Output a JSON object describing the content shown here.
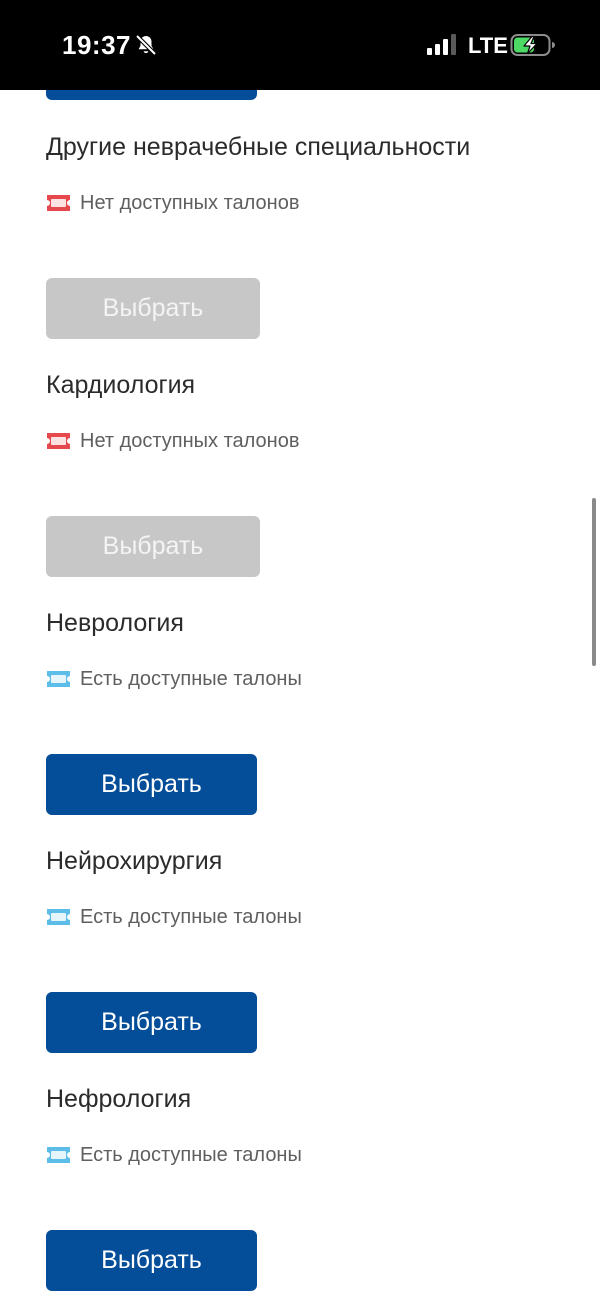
{
  "status_bar": {
    "time": "19:37",
    "network": "LTE",
    "icons": [
      "bell-slash-icon",
      "cellular-signal-icon",
      "battery-charging-icon"
    ]
  },
  "colors": {
    "primary_button": "#044d98",
    "disabled_button": "#c7c7c7",
    "no_tickets_icon": "#e5484d",
    "tickets_icon": "#5bbde8"
  },
  "specialties": [
    {
      "name": "Другие неврачебные специальности",
      "status": "Нет доступных талонов",
      "available": false,
      "button": "Выбрать"
    },
    {
      "name": "Кардиология",
      "status": "Нет доступных талонов",
      "available": false,
      "button": "Выбрать"
    },
    {
      "name": "Неврология",
      "status": "Есть доступные талоны",
      "available": true,
      "button": "Выбрать"
    },
    {
      "name": "Нейрохирургия",
      "status": "Есть доступные талоны",
      "available": true,
      "button": "Выбрать"
    },
    {
      "name": "Нефрология",
      "status": "Есть доступные талоны",
      "available": true,
      "button": "Выбрать"
    }
  ]
}
